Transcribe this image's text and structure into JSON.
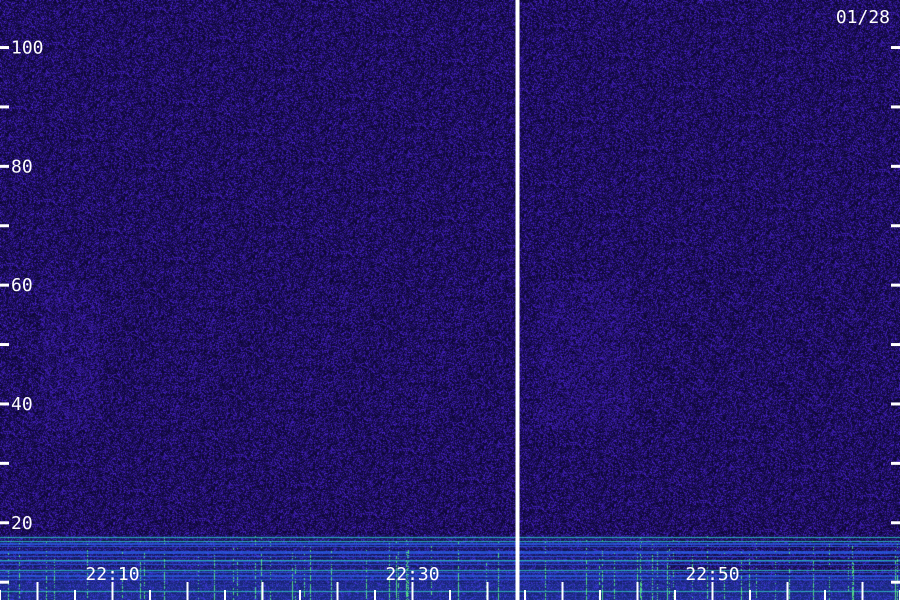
{
  "date": "01/28",
  "colors": {
    "background": "#160e4a",
    "noise_low": "#0c0630",
    "noise_high": "#4a24d0",
    "band_blue": "#2a6bff",
    "band_cyan": "#30e0d0",
    "band_green": "#60ff80",
    "axis": "#ffffff"
  },
  "chart_data": {
    "type": "heatmap",
    "title": "",
    "xlabel": "",
    "ylabel": "",
    "y_ticks": [
      {
        "value": 100,
        "label": "100"
      },
      {
        "value": 90,
        "label": ""
      },
      {
        "value": 80,
        "label": "80"
      },
      {
        "value": 70,
        "label": ""
      },
      {
        "value": 60,
        "label": "60"
      },
      {
        "value": 50,
        "label": ""
      },
      {
        "value": 40,
        "label": "40"
      },
      {
        "value": 30,
        "label": ""
      },
      {
        "value": 20,
        "label": "20"
      },
      {
        "value": 10,
        "label": ""
      }
    ],
    "ylim": [
      7,
      108
    ],
    "x_time_labels": [
      "22:10",
      "22:30",
      "22:50"
    ],
    "x_time_minutes": [
      1330,
      1350,
      1370
    ],
    "xlim_minutes": [
      1322.5,
      1382.5
    ],
    "split_marker_minute": 1357,
    "low_band_top": 18,
    "grid": false,
    "legend": "none"
  }
}
